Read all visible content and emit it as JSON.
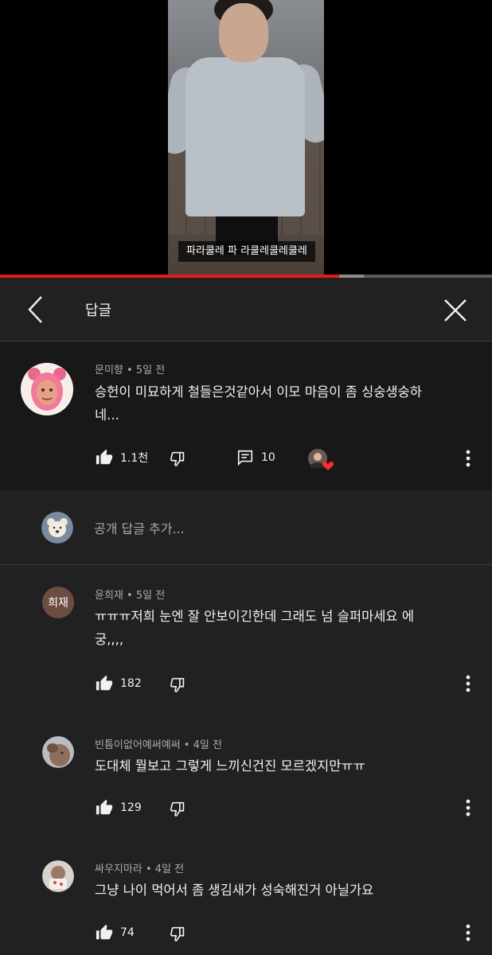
{
  "video": {
    "caption": "파라쿨레 파 라쿨레쿨레쿨레",
    "played_fraction": 0.69,
    "buffered_fraction": 0.74,
    "progress_color": "#e01c1c"
  },
  "header": {
    "title": "답글",
    "back_icon": "chevron-left-icon",
    "close_icon": "close-icon"
  },
  "parent_comment": {
    "author": "문미향",
    "time": "5일 전",
    "text_line1": "승헌이 미묘하게 철들은것같아서 이모 마음이 좀 싱숭생숭하",
    "text_line2": "네...",
    "likes": "1.1천",
    "replies": "10",
    "creator_heart": true
  },
  "reply_box": {
    "placeholder": "공개 답글 추가..."
  },
  "replies": [
    {
      "author": "윤희재",
      "time": "5일 전",
      "avatar_text": "희재",
      "text_line1": "ㅠㅠㅠ저희 눈엔 잘 안보이긴한데 그래도 넘 슬퍼마세요 에",
      "text_line2": "궁,,,,",
      "likes": "182"
    },
    {
      "author": "빈틈이없어예써예써",
      "time": "4일 전",
      "text_line1": "도대체 뭘보고 그렇게 느끼신건진 모르겠지만ㅠㅠ",
      "likes": "129"
    },
    {
      "author": "싸우지마라",
      "time": "4일 전",
      "text_line1": "그냥 나이 먹어서 좀 생김새가 성숙해진거 아닐가요",
      "likes": "74"
    }
  ],
  "separator": " • "
}
